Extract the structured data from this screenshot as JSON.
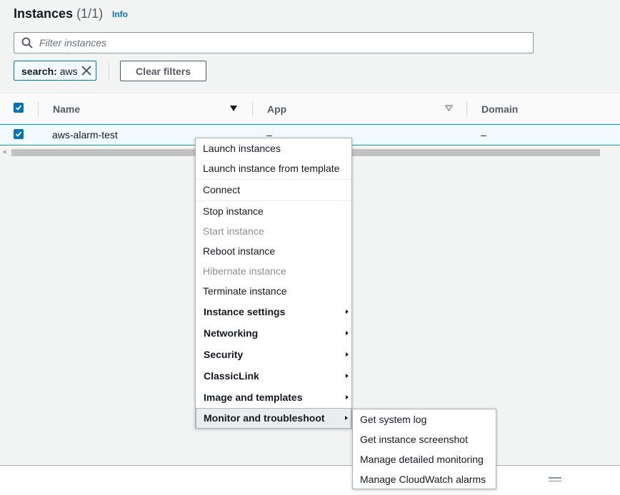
{
  "header": {
    "title": "Instances",
    "count": "(1/1)",
    "info_link": "Info"
  },
  "filter": {
    "placeholder": "Filter instances",
    "value": "",
    "token_key": "search:",
    "token_value": "aws",
    "clear_button": "Clear filters"
  },
  "table": {
    "columns": [
      "Name",
      "App",
      "Domain"
    ],
    "rows": [
      {
        "name": "aws-alarm-test",
        "app": "–",
        "domain": "–",
        "selected": true
      }
    ]
  },
  "context_menu": {
    "items": [
      {
        "label": "Launch instances",
        "style": "normal"
      },
      {
        "label": "Launch instance from template",
        "style": "normal"
      },
      {
        "label": "Connect",
        "style": "normal"
      },
      {
        "label": "Stop instance",
        "style": "normal"
      },
      {
        "label": "Start instance",
        "style": "disabled"
      },
      {
        "label": "Reboot instance",
        "style": "normal"
      },
      {
        "label": "Hibernate instance",
        "style": "disabled"
      },
      {
        "label": "Terminate instance",
        "style": "normal"
      },
      {
        "label": "Instance settings",
        "style": "submenu"
      },
      {
        "label": "Networking",
        "style": "submenu"
      },
      {
        "label": "Security",
        "style": "submenu"
      },
      {
        "label": "ClassicLink",
        "style": "submenu"
      },
      {
        "label": "Image and templates",
        "style": "submenu"
      },
      {
        "label": "Monitor and troubleshoot",
        "style": "submenu-active"
      }
    ],
    "submenu_items": [
      "Get system log",
      "Get instance screenshot",
      "Manage detailed monitoring",
      "Manage CloudWatch alarms"
    ]
  },
  "colors": {
    "accent": "#0073bb",
    "selected_row": "#f1faff",
    "disabled_text": "#8d9096"
  }
}
